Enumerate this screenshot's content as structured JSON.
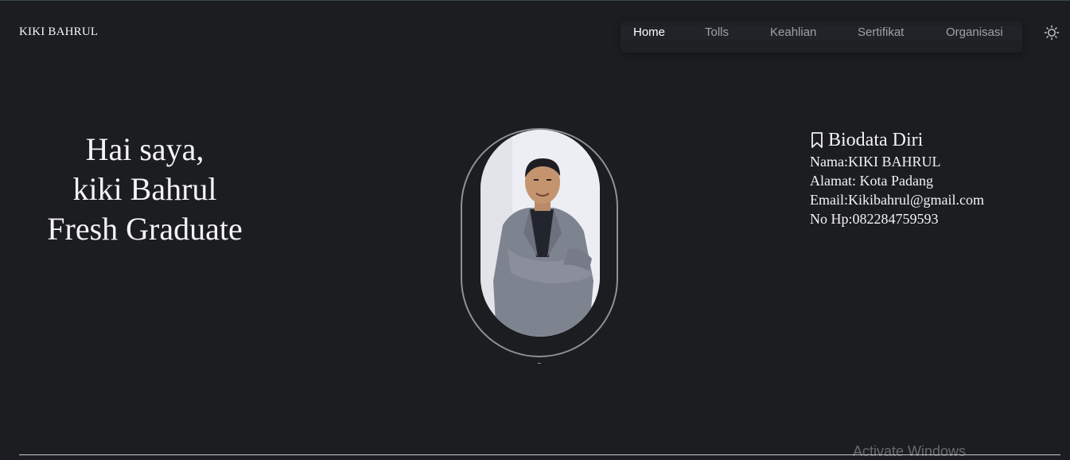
{
  "brand": "KIKI BAHRUL",
  "nav": {
    "items": [
      {
        "label": "Home",
        "active": true
      },
      {
        "label": "Tolls",
        "active": false
      },
      {
        "label": "Keahlian",
        "active": false
      },
      {
        "label": "Sertifikat",
        "active": false
      },
      {
        "label": "Organisasi",
        "active": false
      }
    ],
    "theme_toggle_icon": "sun-icon"
  },
  "hero": {
    "line1": "Hai saya,",
    "line2": "kiki Bahrul",
    "line3": "Fresh Graduate"
  },
  "bio": {
    "title": "Biodata Diri",
    "title_icon": "bookmark-icon",
    "lines": [
      "Nama:KIKI BAHRUL",
      "Alamat: Kota Padang",
      "Email:Kikibahrul@gmail.com",
      "No Hp:082284759593"
    ]
  },
  "watermark": "Activate Windows",
  "colors": {
    "background": "#1b1d20",
    "text": "#f2f2f2",
    "nav_inactive": "#9ea3a8",
    "frame": "#8e9196"
  }
}
